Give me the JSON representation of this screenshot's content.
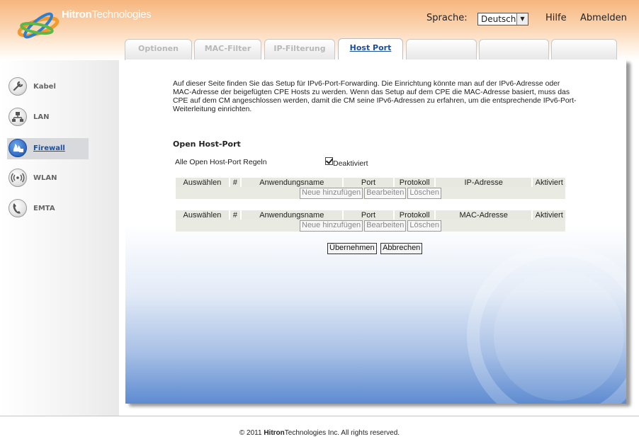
{
  "header": {
    "logo_bold": "Hitron",
    "logo_light": "Technologies",
    "language_label": "Sprache:",
    "language_value": "Deutsch",
    "help": "Hilfe",
    "logout": "Abmelden"
  },
  "tabs": [
    {
      "label": "Optionen",
      "active": false
    },
    {
      "label": "MAC-Filter",
      "active": false
    },
    {
      "label": "IP-Filterung",
      "active": false
    },
    {
      "label": "Host Port",
      "active": true
    },
    {
      "label": "",
      "active": false
    },
    {
      "label": "",
      "active": false
    },
    {
      "label": "",
      "active": false
    }
  ],
  "sidebar": {
    "items": [
      {
        "label": "Kabel",
        "icon": "wrench-icon",
        "active": false
      },
      {
        "label": "LAN",
        "icon": "network-icon",
        "active": false
      },
      {
        "label": "Firewall",
        "icon": "firewall-icon",
        "active": true
      },
      {
        "label": "WLAN",
        "icon": "wireless-icon",
        "active": false
      },
      {
        "label": "EMTA",
        "icon": "phone-icon",
        "active": false
      }
    ]
  },
  "main": {
    "intro": "Auf dieser Seite finden Sie das Setup für IPv6-Port-Forwarding. Die Einrichtung könnte man auf der IPv6-Adresse oder MAC-Adresse der beigefügten CPE Hosts zu werden. Wenn das Setup auf dem CPE die MAC-Adresse basiert, muss das CPE auf dem CM angeschlossen werden, damit die CM seine IPv6-Adressen zu erfahren, um die entsprechende IPv6-Port-Weiterleitung einrichten.",
    "section_title": "Open Host-Port",
    "all_rules_label": "Alle Open Host-Port Regeln",
    "disabled_label": "Deaktiviert",
    "disabled_checked": true,
    "table_ip": {
      "headers": [
        "Auswählen",
        "#",
        "Anwendungsname",
        "Port",
        "Protokoll",
        "IP-Adresse",
        "Aktiviert"
      ]
    },
    "table_mac": {
      "headers": [
        "Auswählen",
        "#",
        "Anwendungsname",
        "Port",
        "Protokoll",
        "MAC-Adresse",
        "Aktiviert"
      ]
    },
    "buttons": {
      "add": "Neue hinzufügen",
      "edit": "Bearbeiten",
      "delete": "Löschen",
      "apply": "Übernehmen",
      "cancel": "Abbrechen"
    }
  },
  "footer": {
    "prefix": "© 2011 ",
    "company_bold": "Hitron",
    "company_light": "Technologies",
    "suffix": " Inc.  All rights reserved."
  },
  "colors": {
    "header_orange": "#f7b67e",
    "active_tab_text": "#1a4fa0",
    "panel_blue": "#5d8bd1"
  }
}
